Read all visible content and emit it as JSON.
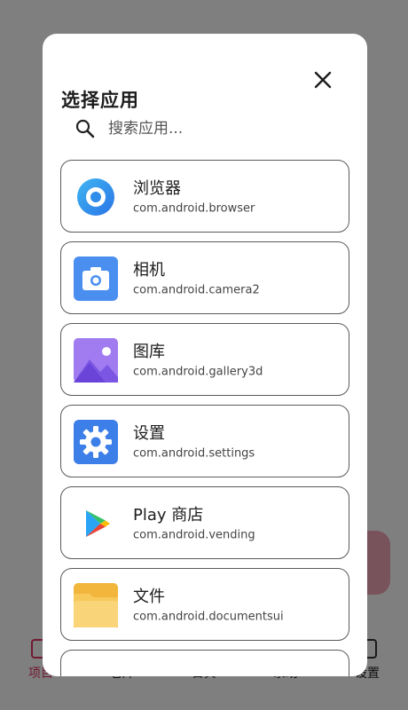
{
  "dialog": {
    "title": "选择应用",
    "search_placeholder": "搜索应用..."
  },
  "apps": [
    {
      "name": "浏览器",
      "package": "com.android.browser",
      "icon": "browser-icon"
    },
    {
      "name": "相机",
      "package": "com.android.camera2",
      "icon": "camera-icon"
    },
    {
      "name": "图库",
      "package": "com.android.gallery3d",
      "icon": "gallery-icon"
    },
    {
      "name": "设置",
      "package": "com.android.settings",
      "icon": "settings-gear-icon"
    },
    {
      "name": "Play 商店",
      "package": "com.android.vending",
      "icon": "play-store-icon"
    },
    {
      "name": "文件",
      "package": "com.android.documentsui",
      "icon": "folder-icon"
    }
  ],
  "background_nav": [
    {
      "label": "项目",
      "icon": "project-icon"
    },
    {
      "label": "仓库",
      "icon": "repository-icon"
    },
    {
      "label": "日贝",
      "icon": "log-icon"
    },
    {
      "label": "录助",
      "icon": "assist-icon"
    },
    {
      "label": "设置",
      "icon": "settings-icon"
    }
  ],
  "colors": {
    "accent": "#d9345f",
    "scrim": "#7a7a7a",
    "card_border": "#5a5a5a"
  }
}
